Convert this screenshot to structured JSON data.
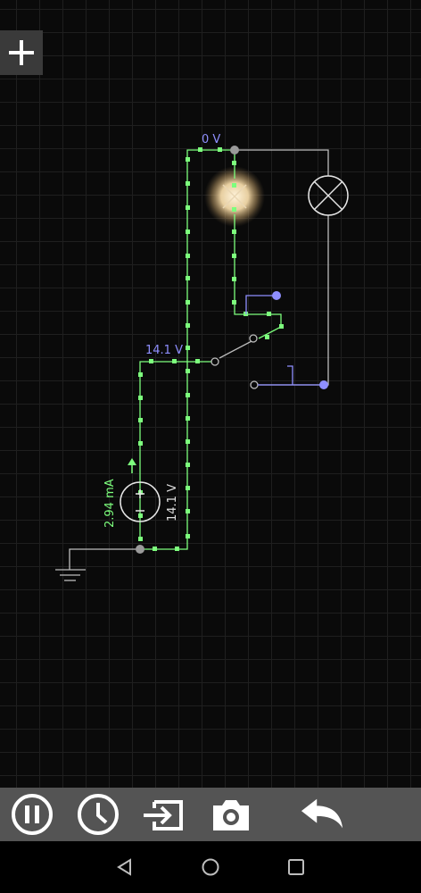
{
  "app": {
    "accent_current": "#7dff7d",
    "accent_voltage": "#8f8fff",
    "wire_color": "#bdbdbd",
    "toolbar_bg": "#545454"
  },
  "circuit": {
    "top_node_voltage": "0 V",
    "mid_node_voltage": "14.1 V",
    "source_current": "2.94 mA",
    "source_voltage": "14.1 V"
  },
  "toolbar": {
    "items": [
      {
        "icon": "pause-icon",
        "label": "Pause"
      },
      {
        "icon": "clock-icon",
        "label": "Timing"
      },
      {
        "icon": "export-icon",
        "label": "Export"
      },
      {
        "icon": "camera-icon",
        "label": "Screenshot"
      },
      {
        "icon": "undo-icon",
        "label": "Undo"
      }
    ]
  },
  "navbar": {
    "items": [
      {
        "icon": "back-icon"
      },
      {
        "icon": "home-icon"
      },
      {
        "icon": "recents-icon"
      }
    ]
  }
}
